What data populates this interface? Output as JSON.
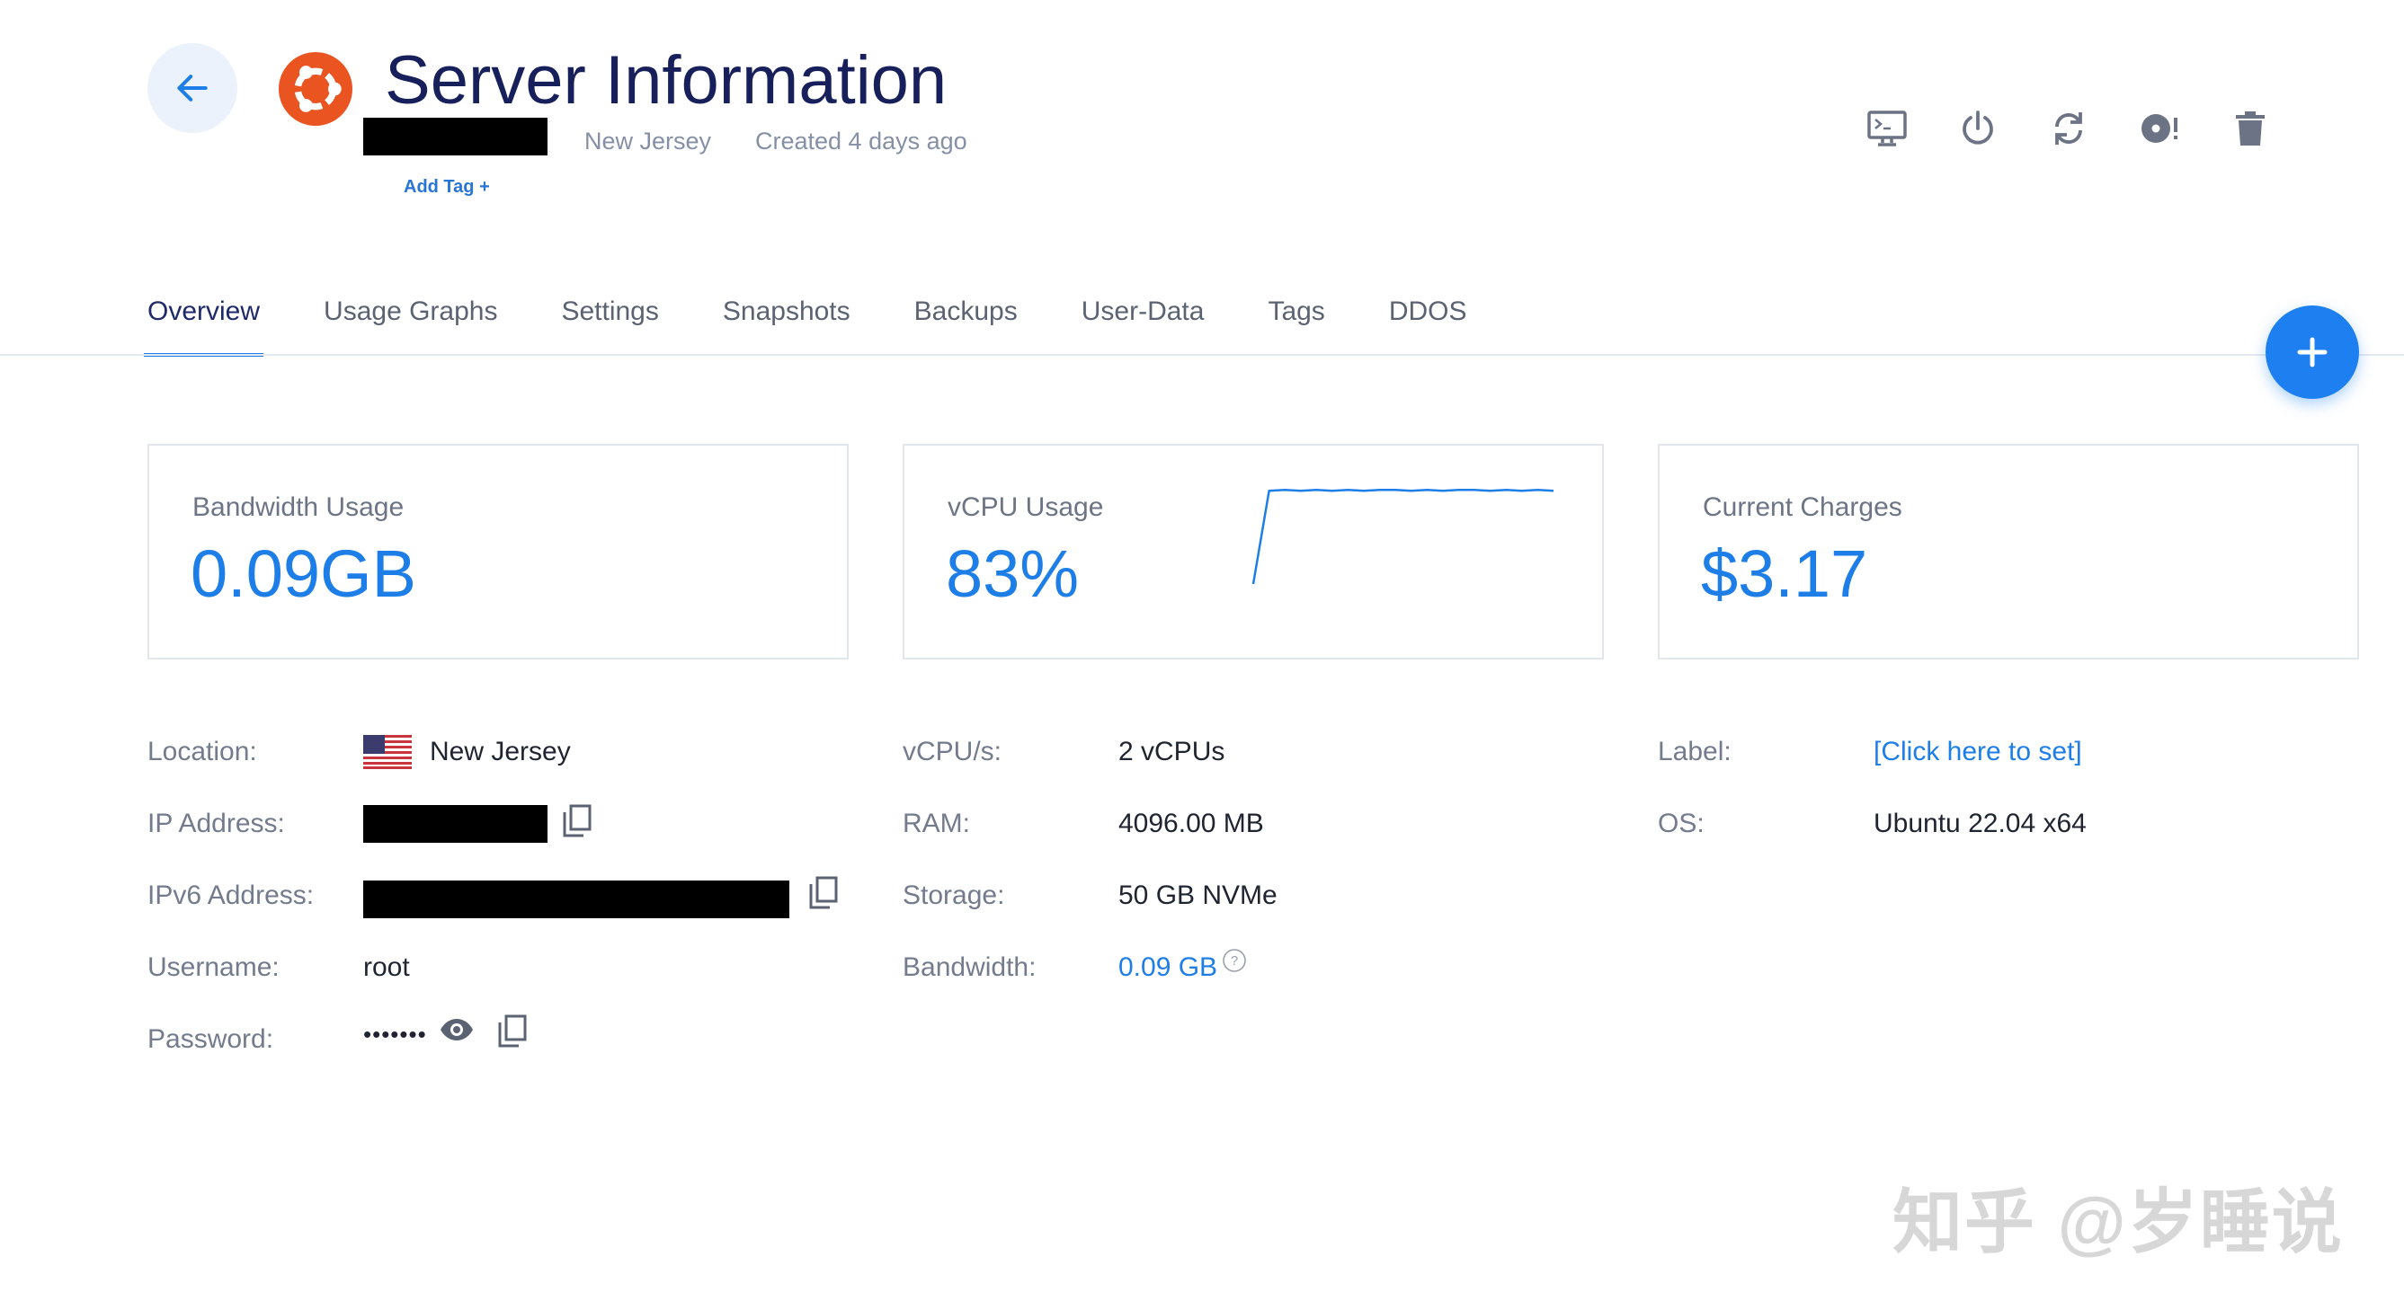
{
  "header": {
    "title": "Server Information",
    "location": "New Jersey",
    "created": "Created 4 days ago",
    "add_tag": "Add Tag +"
  },
  "colors": {
    "accent": "#1e7ee8",
    "title": "#18205c",
    "ubuntu": "#e95420"
  },
  "actions": [
    "console-icon",
    "power-icon",
    "restart-icon",
    "reinstall-icon",
    "delete-icon"
  ],
  "tabs": [
    {
      "label": "Overview",
      "active": true
    },
    {
      "label": "Usage Graphs"
    },
    {
      "label": "Settings"
    },
    {
      "label": "Snapshots"
    },
    {
      "label": "Backups"
    },
    {
      "label": "User-Data"
    },
    {
      "label": "Tags"
    },
    {
      "label": "DDOS"
    }
  ],
  "cards": {
    "bandwidth": {
      "title": "Bandwidth Usage",
      "value": "0.09GB"
    },
    "vcpu": {
      "title": "vCPU Usage",
      "value": "83%",
      "sparkline": [
        0,
        96,
        97,
        96,
        97,
        96,
        97,
        96,
        97,
        97,
        96,
        97,
        96,
        97,
        97,
        96,
        97,
        96,
        97,
        96
      ]
    },
    "charges": {
      "title": "Current Charges",
      "value": "$3.17"
    }
  },
  "details": {
    "location_label": "Location:",
    "location_value": "New Jersey",
    "ip_label": "IP Address:",
    "ipv6_label": "IPv6 Address:",
    "username_label": "Username:",
    "username_value": "root",
    "password_label": "Password:",
    "password_value": "•••••••",
    "vcpus_label": "vCPU/s:",
    "vcpus_value": "2 vCPUs",
    "ram_label": "RAM:",
    "ram_value": "4096.00 MB",
    "storage_label": "Storage:",
    "storage_value": "50 GB NVMe",
    "bandwidth_label": "Bandwidth:",
    "bandwidth_value": "0.09 GB",
    "label_label": "Label:",
    "label_value": "[Click here to set]",
    "os_label": "OS:",
    "os_value": "Ubuntu 22.04 x64"
  },
  "watermark": "知乎 @岁睡说"
}
